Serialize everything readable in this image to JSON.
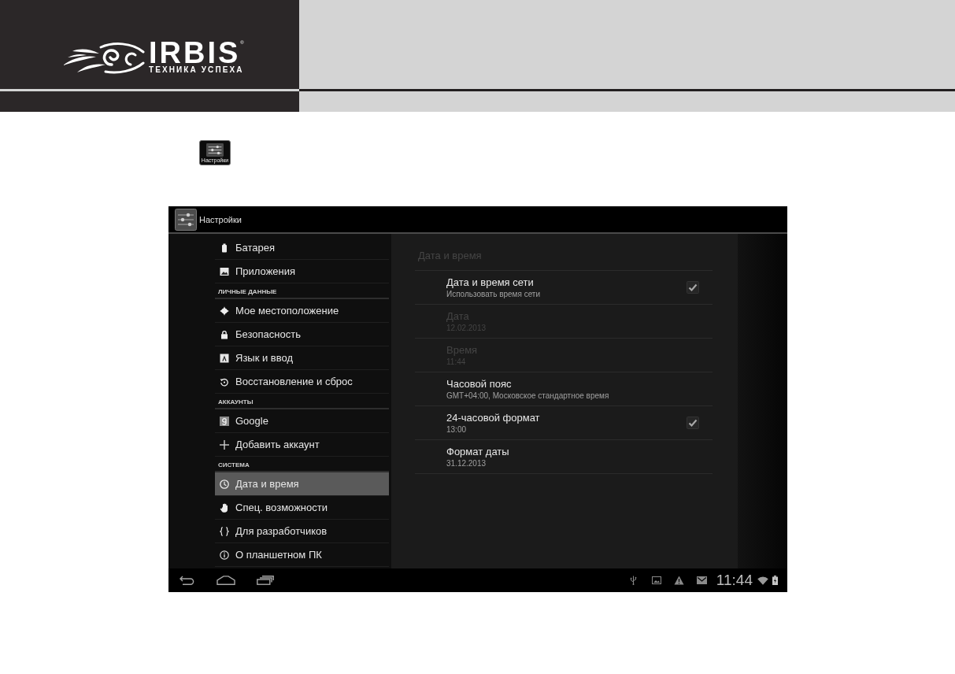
{
  "brand": {
    "name": "IRBIS",
    "mark": "®",
    "tagline": "ТЕХНИКА УСПЕХА"
  },
  "app_icon": {
    "label": "Настройки"
  },
  "screen": {
    "action_bar": {
      "title": "Настройки"
    },
    "sidebar": {
      "items": [
        {
          "kind": "item",
          "label": "Батарея",
          "selected": false
        },
        {
          "kind": "item",
          "label": "Приложения",
          "selected": false
        },
        {
          "kind": "header",
          "label": "ЛИЧНЫЕ ДАННЫЕ"
        },
        {
          "kind": "item",
          "label": "Мое местоположение",
          "selected": false
        },
        {
          "kind": "item",
          "label": "Безопасность",
          "selected": false
        },
        {
          "kind": "item",
          "label": "Язык и ввод",
          "selected": false
        },
        {
          "kind": "item",
          "label": "Восстановление и сброс",
          "selected": false
        },
        {
          "kind": "header",
          "label": "АККАУНТЫ"
        },
        {
          "kind": "item",
          "label": "Google",
          "selected": false
        },
        {
          "kind": "item",
          "label": "Добавить аккаунт",
          "selected": false
        },
        {
          "kind": "header",
          "label": "СИСТЕМА"
        },
        {
          "kind": "item",
          "label": "Дата и время",
          "selected": true
        },
        {
          "kind": "item",
          "label": "Спец. возможности",
          "selected": false
        },
        {
          "kind": "item",
          "label": "Для разработчиков",
          "selected": false
        },
        {
          "kind": "item",
          "label": "О планшетном ПК",
          "selected": false
        }
      ]
    },
    "panel": {
      "title": "Дата и время",
      "rows": [
        {
          "kind": "checkbox",
          "title": "Дата и время сети",
          "summary": "Использовать время сети",
          "disabled": false,
          "checked": true
        },
        {
          "kind": "plain",
          "title": "Дата",
          "summary": "12.02.2013",
          "disabled": true
        },
        {
          "kind": "plain",
          "title": "Время",
          "summary": "11:44",
          "disabled": true
        },
        {
          "kind": "plain",
          "title": "Часовой пояс",
          "summary": "GMT+04:00, Московское стандартное время",
          "disabled": false
        },
        {
          "kind": "checkbox",
          "title": "24-часовой формат",
          "summary": "13:00",
          "disabled": false,
          "checked": true
        },
        {
          "kind": "plain",
          "title": "Формат даты",
          "summary": "31.12.2013",
          "disabled": false
        }
      ]
    },
    "system_bar": {
      "time": "11:44"
    }
  }
}
